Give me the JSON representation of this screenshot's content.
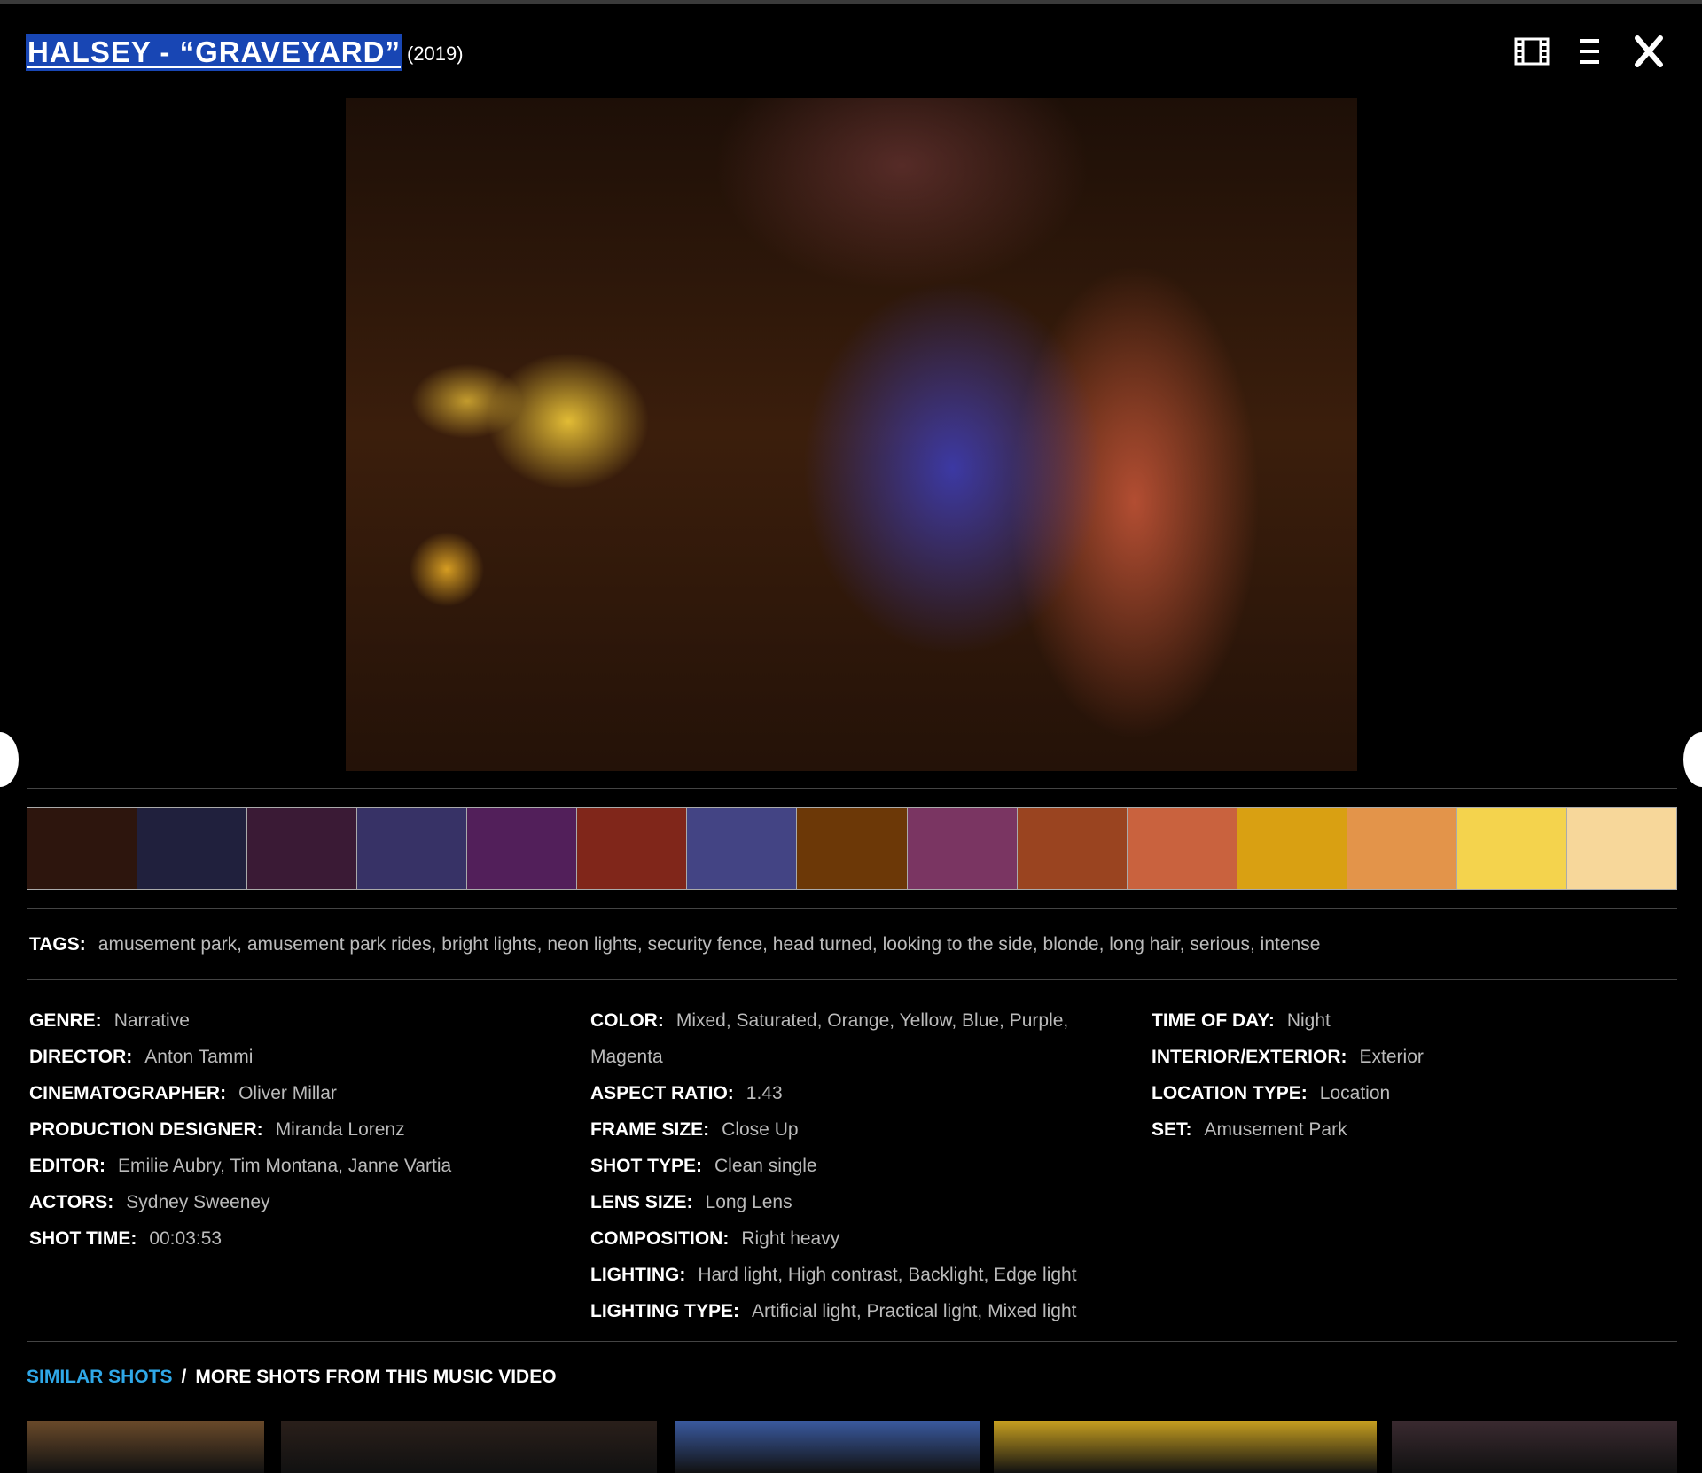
{
  "header": {
    "title": "HALSEY - “GRAVEYARD”",
    "year": "(2019)",
    "icons": [
      "film-icon",
      "menu-icon",
      "close-icon"
    ]
  },
  "hero": {
    "icon": "still-frame-image"
  },
  "palette": {
    "colors": [
      "#2d150d",
      "#20203d",
      "#3a1a35",
      "#373266",
      "#521f5a",
      "#80261a",
      "#434484",
      "#6c3807",
      "#7a3562",
      "#9a4420",
      "#c9623e",
      "#d9a012",
      "#e3944a",
      "#f4d34d",
      "#f7d79a"
    ]
  },
  "tags": {
    "label": "TAGS:",
    "value": "amusement park, amusement park rides, bright lights, neon lights, security fence, head turned, looking to the side, blonde, long hair, serious, intense"
  },
  "details": {
    "col1": [
      {
        "label": "GENRE:",
        "value": "Narrative"
      },
      {
        "label": "DIRECTOR:",
        "value": "Anton Tammi"
      },
      {
        "label": "CINEMATOGRAPHER:",
        "value": "Oliver Millar"
      },
      {
        "label": "PRODUCTION DESIGNER:",
        "value": "Miranda Lorenz"
      },
      {
        "label": "EDITOR:",
        "value": "Emilie Aubry, Tim Montana, Janne Vartia"
      },
      {
        "label": "ACTORS:",
        "value": "Sydney Sweeney"
      },
      {
        "label": "SHOT TIME:",
        "value": "00:03:53"
      }
    ],
    "col2": [
      {
        "label": "COLOR:",
        "value": "Mixed, Saturated, Orange, Yellow, Blue, Purple, Magenta"
      },
      {
        "label": "ASPECT RATIO:",
        "value": "1.43"
      },
      {
        "label": "FRAME SIZE:",
        "value": "Close Up"
      },
      {
        "label": "SHOT TYPE:",
        "value": "Clean single"
      },
      {
        "label": "LENS SIZE:",
        "value": "Long Lens"
      },
      {
        "label": "COMPOSITION:",
        "value": "Right heavy"
      },
      {
        "label": "LIGHTING:",
        "value": "Hard light, High contrast, Backlight, Edge light"
      },
      {
        "label": "LIGHTING TYPE:",
        "value": "Artificial light, Practical light, Mixed light"
      }
    ],
    "col3": [
      {
        "label": "TIME OF DAY:",
        "value": "Night"
      },
      {
        "label": "INTERIOR/EXTERIOR:",
        "value": "Exterior"
      },
      {
        "label": "LOCATION TYPE:",
        "value": "Location"
      },
      {
        "label": "SET:",
        "value": "Amusement Park"
      }
    ]
  },
  "tabs": {
    "similar": "SIMILAR SHOTS",
    "separator": "/",
    "more": "MORE SHOTS FROM THIS MUSIC VIDEO"
  },
  "thumbnails": {
    "colors": [
      "#6a4a2a",
      "#2a1f1a",
      "#3a5aa0",
      "#c8a020",
      "#3a2a30"
    ]
  }
}
